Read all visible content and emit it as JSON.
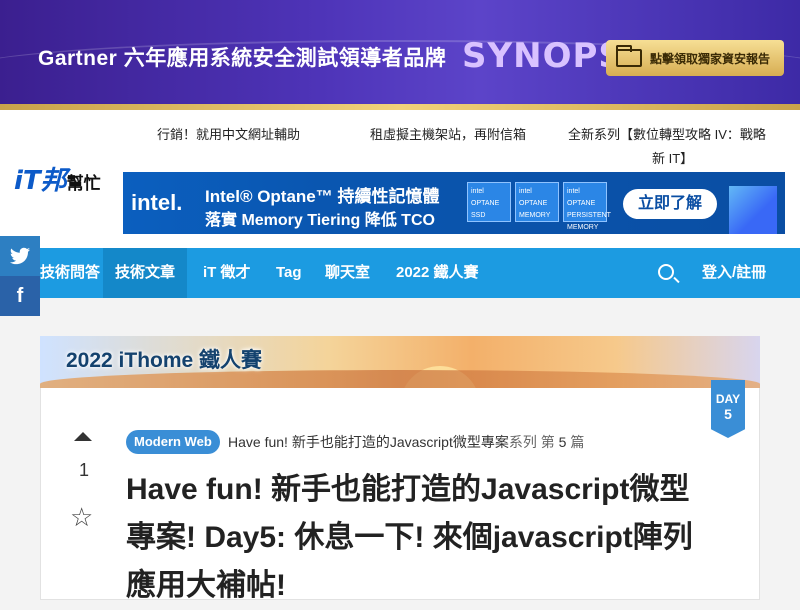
{
  "top_ad": {
    "headline": "Gartner 六年應用系統安全測試領導者品牌",
    "brand": "SYNOPSYS",
    "cta": "點擊領取獨家資安報告"
  },
  "header": {
    "logo_main": "iT邦",
    "logo_sub": "幫忙",
    "promo_links": [
      "行銷！就用中文網址輔助",
      "租虛擬主機架站，再附信箱",
      "全新系列【數位轉型攻略 IV：戰略",
      "新 IT】"
    ]
  },
  "intel_ad": {
    "logo": "intel.",
    "line1": "Intel® Optane™ 持續性記憶體",
    "line2": "落實 Memory Tiering 降低 TCO",
    "chips": [
      "intel OPTANE SSD",
      "intel OPTANE MEMORY",
      "intel OPTANE PERSISTENT MEMORY"
    ],
    "cta": "立即了解"
  },
  "navbar": {
    "items": [
      "技術問答",
      "技術文章",
      "iT 徵才",
      "Tag",
      "聊天室",
      "2022 鐵人賽"
    ],
    "active": "技術文章",
    "login": "登入/註冊"
  },
  "share": {
    "twitter": "t",
    "facebook": "f"
  },
  "ironman": {
    "title": "2022 iThome 鐵人賽",
    "day_label": "DAY",
    "day_number": "5"
  },
  "article": {
    "vote_count": "1",
    "tag": "Modern Web",
    "series_name": "Have fun! 新手也能打造的Javascript微型專案",
    "series_suffix": "系列 第",
    "series_index": "5",
    "series_unit": "篇",
    "title_lines": [
      "Have fun! 新手也能打造的Javascript微型",
      "專案! Day5: 休息一下! 來個javascript陣列",
      "應用大補帖!"
    ]
  }
}
